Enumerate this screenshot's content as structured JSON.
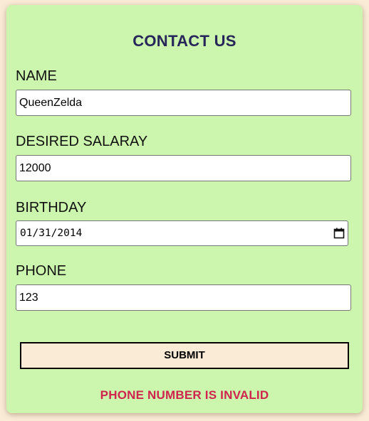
{
  "form": {
    "title": "CONTACT US",
    "fields": {
      "name": {
        "label": "NAME",
        "value": "QueenZelda"
      },
      "salary": {
        "label": "DESIRED SALARAY",
        "value": "12000"
      },
      "birthday": {
        "label": "BIRTHDAY",
        "value": "01/31/2014",
        "icon": "calendar-icon"
      },
      "phone": {
        "label": "PHONE",
        "value": "123"
      }
    },
    "submit_label": "SUBMIT",
    "error_message": "PHONE NUMBER IS INVALID"
  },
  "colors": {
    "page_background": "#faebd7",
    "card_background": "#ccf5ad",
    "title": "#26265a",
    "error": "#d0234d",
    "button_background": "#faebd7"
  }
}
